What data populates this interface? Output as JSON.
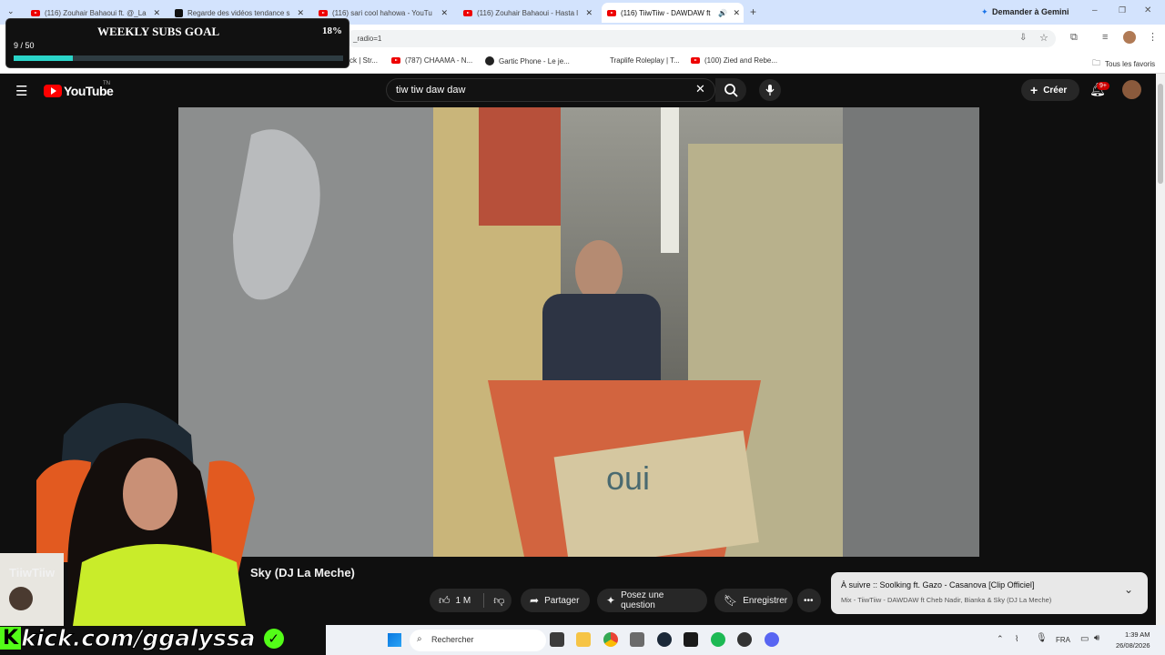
{
  "browser": {
    "tabs": [
      {
        "label": "(116) Zouhair Bahaoui ft. @_La",
        "icon": "youtube-icon"
      },
      {
        "label": "Regarde des vidéos tendance s",
        "icon": "tiktok-icon"
      },
      {
        "label": "(116) sari cool hahowa - YouTu",
        "icon": "youtube-icon"
      },
      {
        "label": "(116) Zouhair Bahaoui - Hasta l",
        "icon": "youtube-icon"
      },
      {
        "label": "(116) TiiwTiiw - DAWDAW ft",
        "icon": "youtube-icon",
        "active": true
      }
    ],
    "gemini_label": "Demander à Gemini",
    "url_fragment": "_radio=1",
    "bookmarks": [
      "ck | Str...",
      "(787) CHAAMA - N...",
      "Gartic Phone - Le je...",
      "Traplife Roleplay | T...",
      "(100) Zied and Rebe..."
    ],
    "all_bookmarks": "Tous les favoris"
  },
  "youtube": {
    "logo": "YouTube",
    "logo_sup": "TN",
    "search_value": "tiw tiw daw daw",
    "create_label": "Créer",
    "notif_badge": "9+",
    "title": "TiiwTiiw - DAWDAW ft Cheb Nadir, Bianka & Sky (DJ La Meche)",
    "title_visible_left": "TiiwTiiw",
    "title_visible_right": "Sky (DJ La Meche)",
    "likes": "1 M",
    "share": "Partager",
    "ask": "Posez une question",
    "save": "Enregistrer",
    "upnext_title": "À suivre :: Soolking ft. Gazo - Casanova [Clip Officiel]",
    "upnext_sub": "Mix - TiiwTiiw - DAWDAW ft Cheb Nadir, Bianka & Sky (DJ La Meche)"
  },
  "overlay": {
    "goal_title": "WEEKLY SUBS GOAL",
    "goal_percent": "18%",
    "goal_count": "9 / 50",
    "goal_fraction": 0.18,
    "kick_text": "kick.com/ggalyssa"
  },
  "taskbar": {
    "search_placeholder": "Rechercher",
    "lang": "FRA",
    "time": "1:39 AM",
    "date": "26/08/2026"
  },
  "colors": {
    "accent_green": "#53fc18",
    "yt_red": "#ff0000",
    "goal_bar": "#2ad4c8"
  }
}
